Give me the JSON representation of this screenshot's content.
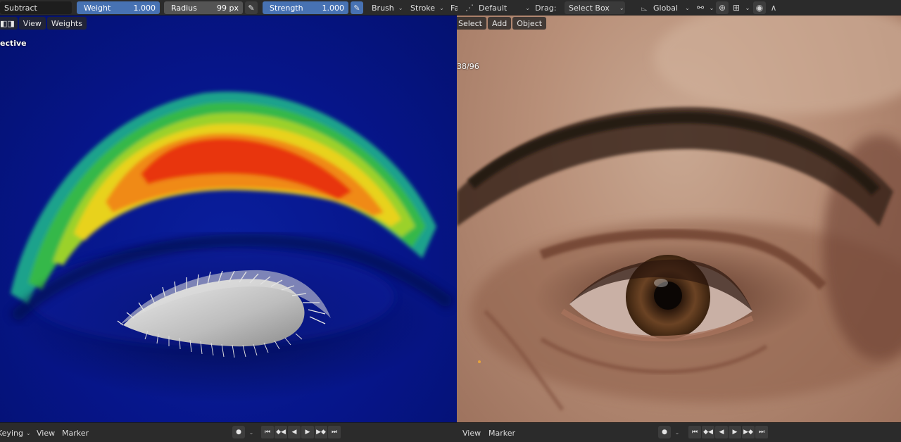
{
  "toolbar": {
    "blend_mode": "Subtract",
    "weight_label": "Weight",
    "weight_value": "1.000",
    "radius_label": "Radius",
    "radius_value": "99 px",
    "strength_label": "Strength",
    "strength_value": "1.000",
    "brush_menu": "Brush",
    "stroke_menu": "Stroke",
    "falloff_menu_partial": "Fa",
    "pivot_label": "Default",
    "drag_label": "Drag:",
    "drag_value": "Select Box",
    "orientation_label": "Global"
  },
  "left_viewport": {
    "view_menu": "View",
    "weights_menu": "Weights",
    "perspective_label": "ective"
  },
  "right_viewport": {
    "select_menu": "Select",
    "add_menu": "Add",
    "object_menu": "Object",
    "sample_counter": "38/96"
  },
  "timeline": {
    "keying_menu": "Keying",
    "view_menu": "View",
    "marker_menu": "Marker",
    "right_view_menu": "View",
    "right_marker_menu": "Marker"
  },
  "icons": {
    "record": "record-icon",
    "jump_start": "jump-start-icon",
    "prev_key": "prev-keyframe-icon",
    "play_reverse": "play-reverse-icon",
    "play": "play-icon",
    "next_key": "next-keyframe-icon",
    "jump_end": "jump-end-icon"
  },
  "colors": {
    "accent": "#4772b3",
    "toolbar_bg": "#2b2b2b",
    "weight_blue": "#061589"
  }
}
